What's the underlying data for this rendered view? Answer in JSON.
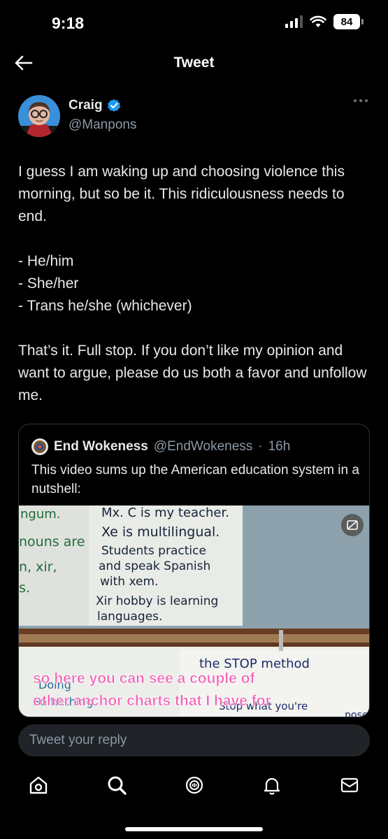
{
  "status": {
    "time": "9:18",
    "battery": "84"
  },
  "header": {
    "title": "Tweet",
    "back_icon": "arrow-left-icon"
  },
  "tweet": {
    "author_name": "Craig",
    "author_handle": "@Manpons",
    "verified": true,
    "text": "I guess I am waking up and choosing violence this morning, but so be it. This ridiculousness needs to end.\n\n- He/him\n- She/her\n- Trans he/she (whichever)\n\nThat’s it. Full stop. If you don’t like my opinion and want to argue, please do us both a favor and unfollow me."
  },
  "quote": {
    "author_name": "End Wokeness",
    "author_handle": "@EndWokeness",
    "separator": "·",
    "time": "16h",
    "text": "This video sums up the American education system in a nutshell:",
    "media": {
      "board_left": [
        "ngum.",
        "nouns are",
        "n, xir,",
        "s."
      ],
      "board_center": [
        "Mx. C is my teacher.",
        "Xe is multilingual.",
        "Students practice",
        "and speak Spanish",
        "with xem.",
        "Xir hobby is learning",
        "languages."
      ],
      "board_right": [
        "the STOP method",
        "Stop what you're",
        "Something",
        "Doing",
        "pose"
      ],
      "caption_line1": "so here you can see a couple of",
      "caption_line2": "other anchor charts that I have for"
    }
  },
  "reply": {
    "placeholder": "Tweet your reply"
  },
  "tabs": [
    "home-icon",
    "search-icon",
    "spaces-icon",
    "notifications-icon",
    "messages-icon"
  ],
  "colors": {
    "background": "#000000",
    "accent": "#1d9bf0",
    "caption": "#f25fb6"
  }
}
